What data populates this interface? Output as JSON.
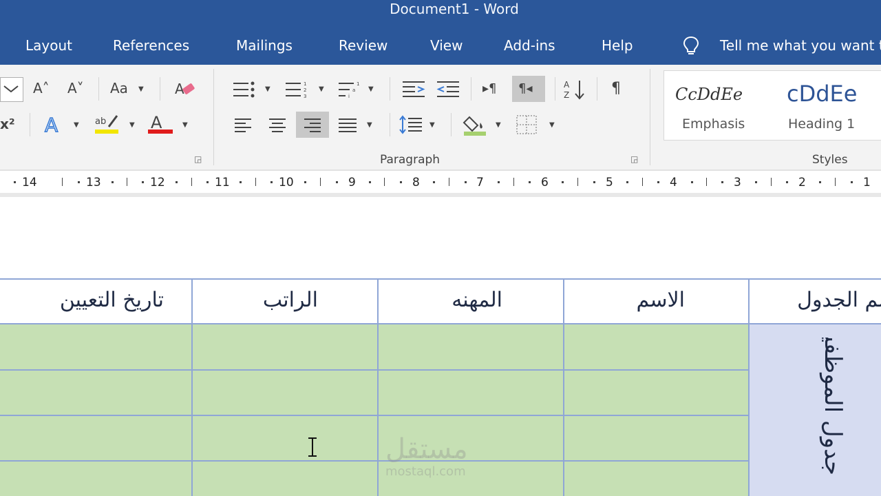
{
  "window": {
    "title": "Document1  -  Word"
  },
  "menu": {
    "tabs": [
      "Layout",
      "References",
      "Mailings",
      "Review",
      "View",
      "Add-ins",
      "Help"
    ],
    "tell_me": "Tell me what you want to do"
  },
  "ribbon": {
    "font_group_icons": {
      "grow_font": "A˄",
      "shrink_font": "A˅",
      "change_case": "Aa",
      "superscript": "x²"
    },
    "paragraph_label": "Paragraph",
    "styles_label": "Styles",
    "styles": [
      {
        "sample": "CcDdEe",
        "name": "Emphasis"
      },
      {
        "sample": "cDdEe",
        "name": "Heading 1"
      }
    ],
    "colors": {
      "highlight": "#f2e600",
      "font_color": "#e01b1b",
      "shading": "#a6d06f"
    }
  },
  "ruler": {
    "numbers": [
      "14",
      "13",
      "12",
      "11",
      "10",
      "9",
      "8",
      "7",
      "6",
      "5",
      "4",
      "3",
      "2",
      "1"
    ]
  },
  "table": {
    "headers": {
      "col1": "تاريخ التعيين",
      "col2": "الراتب",
      "col3": "المهنه",
      "col4": "الاسم",
      "col5": "اسم الجدول"
    },
    "merged_cell_text": "جدول الموظفين",
    "colors": {
      "body": "#c6e0b4",
      "side": "#d6dcf1",
      "border": "#8fa6d6"
    }
  },
  "watermark": {
    "arabic": "مستقل",
    "latin": "mostaql.com"
  }
}
